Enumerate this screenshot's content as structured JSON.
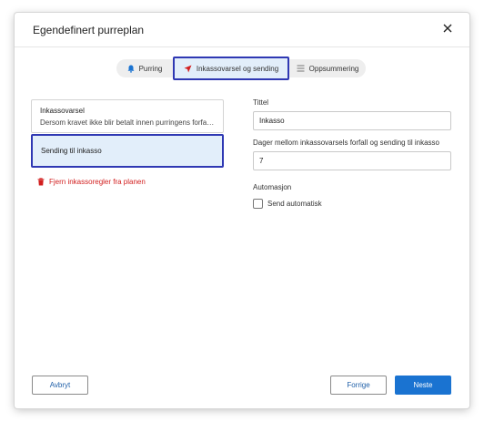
{
  "dialog": {
    "title": "Egendefinert purreplan",
    "close_icon": "close-icon"
  },
  "steps": [
    {
      "label": "Purring",
      "icon": "bell-icon",
      "active": false
    },
    {
      "label": "Inkassovarsel og sending",
      "icon": "send-arrow-icon",
      "active": true
    },
    {
      "label": "Oppsummering",
      "icon": "list-icon",
      "active": false
    }
  ],
  "rules": [
    {
      "title": "Inkassovarsel",
      "description": "Dersom kravet ikke blir betalt innen purringens forfallsdato"
    },
    {
      "title": "Sending til inkasso",
      "selected": true
    }
  ],
  "remove_link": "Fjern inkassoregler fra planen",
  "form": {
    "title_label": "Tittel",
    "title_value": "Inkasso",
    "days_label": "Dager mellom inkassovarsels forfall og sending til inkasso",
    "days_value": "7",
    "automation_label": "Automasjon",
    "send_auto_label": "Send automatisk",
    "send_auto_checked": false
  },
  "buttons": {
    "cancel": "Avbryt",
    "previous": "Forrige",
    "next": "Neste"
  },
  "colors": {
    "accent": "#1a73d1",
    "highlight_border": "#2f38b3",
    "highlight_fill": "#e2eefa",
    "danger": "#d21f1f",
    "bell": "#1a73d1",
    "send_arrow": "#d21f1f"
  }
}
